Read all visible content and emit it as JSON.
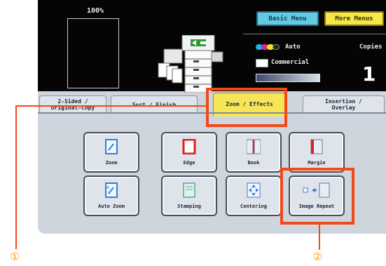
{
  "zoom_display": "100%",
  "menu_buttons": {
    "basic": "Basic Menu",
    "more": "More Menus"
  },
  "status": {
    "color_mode": "Auto",
    "paper_type": "Commercial",
    "copies_label": "Copies",
    "copies_value": "1"
  },
  "tabs": [
    {
      "label": "2-Sided /\nOriginal-Copy",
      "active": false
    },
    {
      "label": "Sort / Finish",
      "active": false
    },
    {
      "label": "Zoom / Effects",
      "active": true
    },
    {
      "label": "Insertion /\nOverlay",
      "active": false
    }
  ],
  "functions": [
    {
      "label": "Zoom",
      "icon": "zoom-icon"
    },
    {
      "label": "Edge",
      "icon": "edge-icon"
    },
    {
      "label": "Book",
      "icon": "book-icon"
    },
    {
      "label": "Margin",
      "icon": "margin-icon"
    },
    {
      "label": "Auto Zoom",
      "icon": "auto-zoom-icon"
    },
    {
      "label": "Stamping",
      "icon": "stamping-icon"
    },
    {
      "label": "Centering",
      "icon": "centering-icon"
    },
    {
      "label": "Image Repeat",
      "icon": "image-repeat-icon"
    }
  ],
  "callouts": {
    "one": "①",
    "two": "②"
  },
  "colors": {
    "highlight": "#f2481a",
    "active_tab": "#f6e557",
    "basic_menu": "#64c9e1",
    "more_menus": "#f5e64a",
    "callout_text": "#f0a020"
  }
}
